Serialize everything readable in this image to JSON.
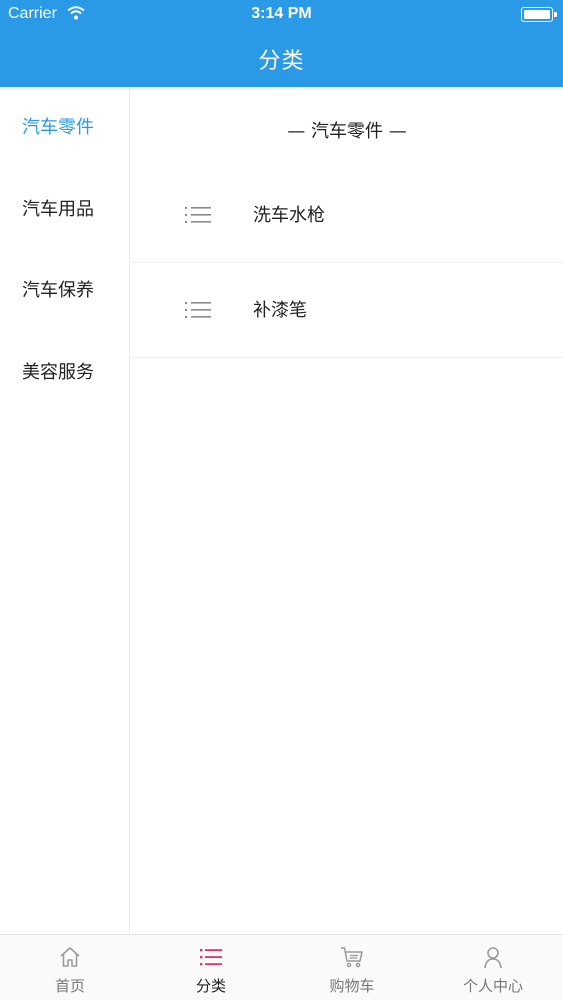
{
  "status_bar": {
    "carrier": "Carrier",
    "time": "3:14 PM"
  },
  "header": {
    "title": "分类"
  },
  "sidebar": {
    "items": [
      {
        "label": "汽车零件",
        "active": true
      },
      {
        "label": "汽车用品",
        "active": false
      },
      {
        "label": "汽车保养",
        "active": false
      },
      {
        "label": "美容服务",
        "active": false
      }
    ]
  },
  "content": {
    "section_title": "— 汽车零件 —",
    "items": [
      {
        "label": "洗车水枪",
        "icon": "list-icon"
      },
      {
        "label": "补漆笔",
        "icon": "list-icon"
      }
    ]
  },
  "tabbar": {
    "tabs": [
      {
        "label": "首页",
        "icon": "home-icon",
        "active": false
      },
      {
        "label": "分类",
        "icon": "list-icon",
        "active": true
      },
      {
        "label": "购物车",
        "icon": "cart-icon",
        "active": false
      },
      {
        "label": "个人中心",
        "icon": "user-icon",
        "active": false
      }
    ]
  },
  "colors": {
    "accent": "#2a9ae6",
    "active_tab": "#e0336e",
    "inactive": "#9a9a9a"
  }
}
